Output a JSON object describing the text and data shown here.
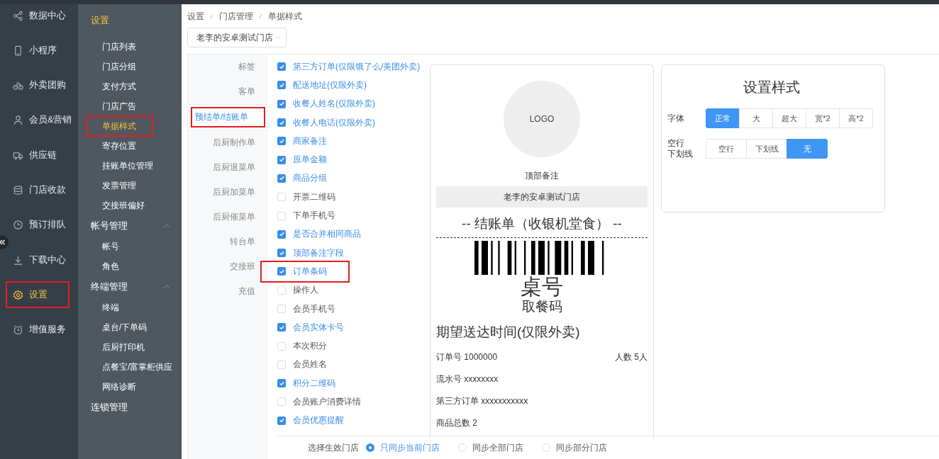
{
  "nav": [
    {
      "label": "数据中心",
      "selected": false
    },
    {
      "label": "小程序",
      "selected": false
    },
    {
      "label": "外卖团购",
      "selected": false
    },
    {
      "label": "会员&营销",
      "selected": false
    },
    {
      "label": "供应链",
      "selected": false
    },
    {
      "label": "门店收款",
      "selected": false
    },
    {
      "label": "预订排队",
      "selected": false
    },
    {
      "label": "下载中心",
      "selected": false
    },
    {
      "label": "设置",
      "selected": true,
      "marked": true
    },
    {
      "label": "增值服务",
      "selected": false
    }
  ],
  "subnav": {
    "title": "设置",
    "sections": [
      {
        "items": [
          {
            "label": "门店列表",
            "selected": false
          },
          {
            "label": "门店分组",
            "selected": false
          },
          {
            "label": "支付方式",
            "selected": false
          },
          {
            "label": "门店广告",
            "selected": false
          },
          {
            "label": "单据样式",
            "selected": true,
            "marked": true
          },
          {
            "label": "寄存位置",
            "selected": false
          },
          {
            "label": "挂账单位管理",
            "selected": false
          },
          {
            "label": "发票管理",
            "selected": false
          },
          {
            "label": "交接班偏好",
            "selected": false
          }
        ]
      },
      {
        "title": "帐号管理",
        "expanded": true,
        "items": [
          {
            "label": "帐号",
            "selected": false
          },
          {
            "label": "角色",
            "selected": false
          }
        ]
      },
      {
        "title": "终端管理",
        "expanded": true,
        "items": [
          {
            "label": "终端",
            "selected": false
          },
          {
            "label": "桌台/下单码",
            "selected": false
          },
          {
            "label": "后厨打印机",
            "selected": false
          },
          {
            "label": "点餐宝/富掌柜供应",
            "selected": false
          },
          {
            "label": "网络诊断",
            "selected": false
          }
        ]
      },
      {
        "title": "连锁管理"
      }
    ]
  },
  "breadcrumb": [
    "设置",
    "门店管理",
    "单据样式"
  ],
  "store_select": {
    "value": "老李的安卓测试门店"
  },
  "receipt_tabs": [
    {
      "label": "标签",
      "selected": false
    },
    {
      "label": "客单",
      "selected": false
    },
    {
      "label": "预结单/结账单",
      "selected": true,
      "marked": true
    },
    {
      "label": "后厨制作单",
      "selected": false
    },
    {
      "label": "后厨退菜单",
      "selected": false
    },
    {
      "label": "后厨加菜单",
      "selected": false
    },
    {
      "label": "后厨催菜单",
      "selected": false
    },
    {
      "label": "转台单",
      "selected": false
    },
    {
      "label": "交接班",
      "selected": false
    },
    {
      "label": "充值",
      "selected": false
    }
  ],
  "fields": [
    {
      "label": "第三方订单(仅限饿了么/美团外卖)",
      "checked": true
    },
    {
      "label": "配送地址(仅限外卖)",
      "checked": true
    },
    {
      "label": "收餐人姓名(仅限外卖)",
      "checked": true
    },
    {
      "label": "收餐人电话(仅限外卖)",
      "checked": true
    },
    {
      "label": "商家备注",
      "checked": true
    },
    {
      "label": "原单金额",
      "checked": true
    },
    {
      "label": "商品分组",
      "checked": true
    },
    {
      "label": "开票二维码",
      "checked": false
    },
    {
      "label": "下单手机号",
      "checked": false
    },
    {
      "label": "是否合并相同商品",
      "checked": true
    },
    {
      "label": "顶部备注字段",
      "checked": true
    },
    {
      "label": "订单条码",
      "checked": true,
      "marked": true
    },
    {
      "label": "操作人",
      "checked": false
    },
    {
      "label": "会员手机号",
      "checked": false
    },
    {
      "label": "会员实体卡号",
      "checked": true
    },
    {
      "label": "本次积分",
      "checked": false
    },
    {
      "label": "会员姓名",
      "checked": false
    },
    {
      "label": "积分二维码",
      "checked": true
    },
    {
      "label": "会员账户消费详情",
      "checked": false
    },
    {
      "label": "会员优惠提醒",
      "checked": true
    }
  ],
  "preview": {
    "logo": "LOGO",
    "top_note": "顶部备注",
    "store_name": "老李的安卓测试门店",
    "title": "-- 结账单（收银机堂食） --",
    "table_no": "桌号",
    "pickup_code": "取餐码",
    "delivery_time": "期望送达时间(仅限外卖)",
    "order_no": "订单号 1000000",
    "guests": "人数 5人",
    "lines": [
      "流水号 xxxxxxxx",
      "第三方订单 xxxxxxxxxxx",
      "商品总数 2"
    ]
  },
  "style_panel": {
    "title": "设置样式",
    "rows": [
      {
        "label": [
          "字体"
        ],
        "options": [
          {
            "label": "正常",
            "selected": true
          },
          {
            "label": "大",
            "selected": false
          },
          {
            "label": "超大",
            "selected": false
          },
          {
            "label": "宽*2",
            "selected": false
          },
          {
            "label": "高*2",
            "selected": false
          }
        ]
      },
      {
        "label": [
          "空行",
          "下划线"
        ],
        "options": [
          {
            "label": "空行",
            "selected": false
          },
          {
            "label": "下划线",
            "selected": false
          },
          {
            "label": "无",
            "selected": true
          }
        ]
      }
    ]
  },
  "apply": {
    "label": "选择生效门店",
    "options": [
      {
        "label": "只同步当前门店",
        "selected": true
      },
      {
        "label": "同步全部门店",
        "selected": false
      },
      {
        "label": "同步部分门店",
        "selected": false
      }
    ]
  }
}
